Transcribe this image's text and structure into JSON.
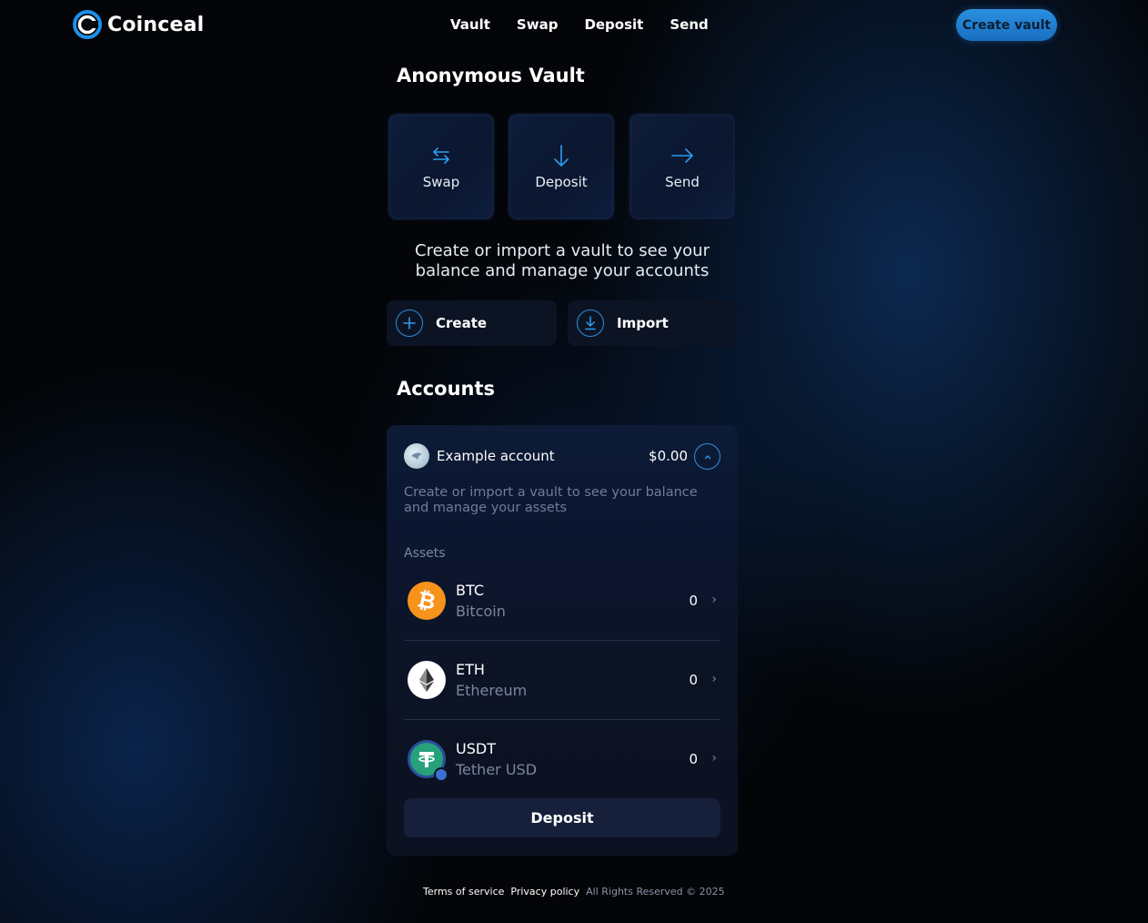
{
  "header": {
    "brand": "Coinceal",
    "nav": [
      "Vault",
      "Swap",
      "Deposit",
      "Send"
    ],
    "cta_label": "Create vault"
  },
  "vault": {
    "title": "Anonymous Vault",
    "actions": [
      {
        "label": "Swap",
        "icon": "swap-icon"
      },
      {
        "label": "Deposit",
        "icon": "arrow-down-icon"
      },
      {
        "label": "Send",
        "icon": "arrow-right-icon"
      }
    ],
    "info": "Create or import a vault to see your balance and manage your accounts",
    "create_label": "Create",
    "import_label": "Import"
  },
  "accounts": {
    "title": "Accounts",
    "account_name": "Example account",
    "balance": "$0.00",
    "note": "Create or import a vault to see your balance and manage your assets",
    "assets_label": "Assets",
    "assets": [
      {
        "symbol": "BTC",
        "name": "Bitcoin",
        "amount": "0",
        "icon": "bitcoin-icon",
        "color": "#f7931a"
      },
      {
        "symbol": "ETH",
        "name": "Ethereum",
        "amount": "0",
        "icon": "ethereum-icon",
        "color": "#ffffff"
      },
      {
        "symbol": "USDT",
        "name": "Tether USD",
        "amount": "0",
        "icon": "tether-icon",
        "color": "#26a17b"
      }
    ],
    "deposit_label": "Deposit"
  },
  "footer": {
    "terms": "Terms of service",
    "privacy": "Privacy policy",
    "copyright": "All Rights Reserved © 2025"
  },
  "colors": {
    "accent": "#2d8fe0",
    "background": "#030508"
  }
}
